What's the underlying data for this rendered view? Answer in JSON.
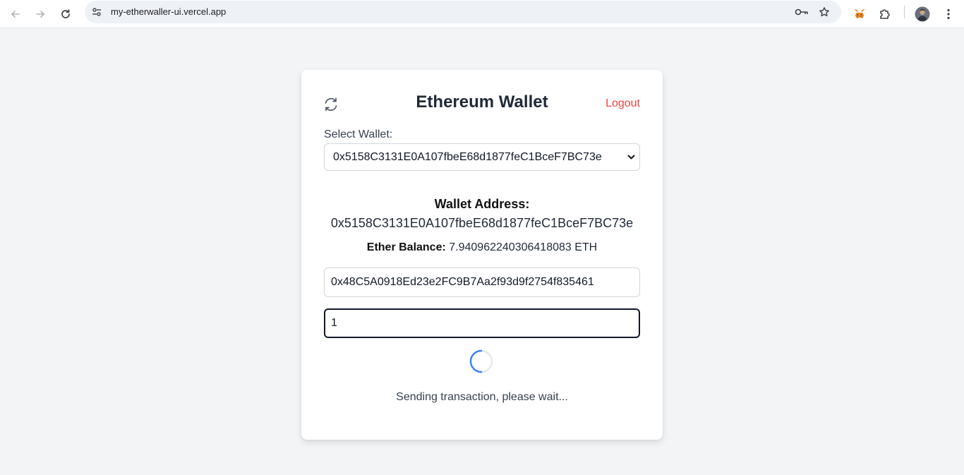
{
  "browser": {
    "url": "my-etherwaller-ui.vercel.app",
    "icons": [
      "back-icon",
      "forward-icon",
      "reload-icon",
      "site-settings-icon",
      "password-key-icon",
      "bookmark-star-icon",
      "metamask-fox-icon",
      "extensions-puzzle-icon",
      "profile-avatar",
      "more-menu-icon"
    ]
  },
  "wallet": {
    "title": "Ethereum Wallet",
    "logout_label": "Logout",
    "select_label": "Select Wallet:",
    "selected_wallet": "0x5158C3131E0A107fbeE68d1877feC1BceF7BC73e",
    "address_label": "Wallet Address:",
    "address_value": "0x5158C3131E0A107fbeE68d1877feC1BceF7BC73e",
    "balance_label": "Ether Balance:",
    "balance_value": "7.940962240306418083 ETH",
    "recipient_value": "0x48C5A0918Ed23e2FC9B7Aa2f93d9f2754f835461",
    "amount_value": "1",
    "status_text": "Sending transaction, please wait..."
  },
  "colors": {
    "logout": "#ef4444",
    "page_bg": "#f3f4f6",
    "spinner": "#3b82f6"
  }
}
